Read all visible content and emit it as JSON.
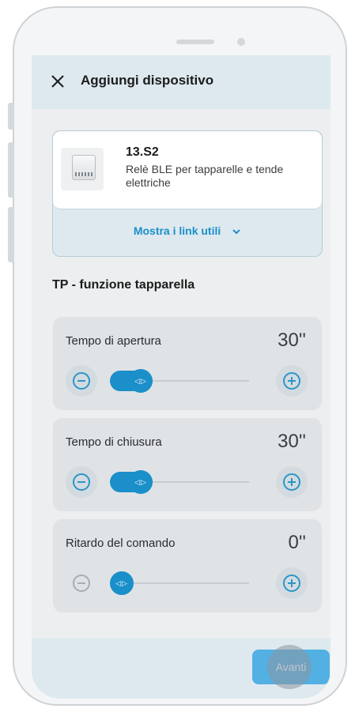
{
  "header": {
    "title": "Aggiungi dispositivo",
    "close_icon": "close-icon"
  },
  "product": {
    "code": "13.S2",
    "description": "Relè BLE per tapparelle e tende elettriche",
    "links_label": "Mostra i link utili",
    "links_icon": "chevron-down-icon"
  },
  "section": {
    "title": "TP - funzione tapparella"
  },
  "sliders": [
    {
      "label": "Tempo di apertura",
      "value": "30''",
      "level": 0.3,
      "minus_enabled": true
    },
    {
      "label": "Tempo di chiusura",
      "value": "30''",
      "level": 0.3,
      "minus_enabled": true
    },
    {
      "label": "Ritardo del comando",
      "value": "0''",
      "level": 0.0,
      "minus_enabled": false
    }
  ],
  "footer": {
    "next_label": "Avanti"
  },
  "colors": {
    "accent": "#1a8fc9",
    "header_bg": "#dde9ef",
    "card_bg": "#e0e3e5"
  }
}
